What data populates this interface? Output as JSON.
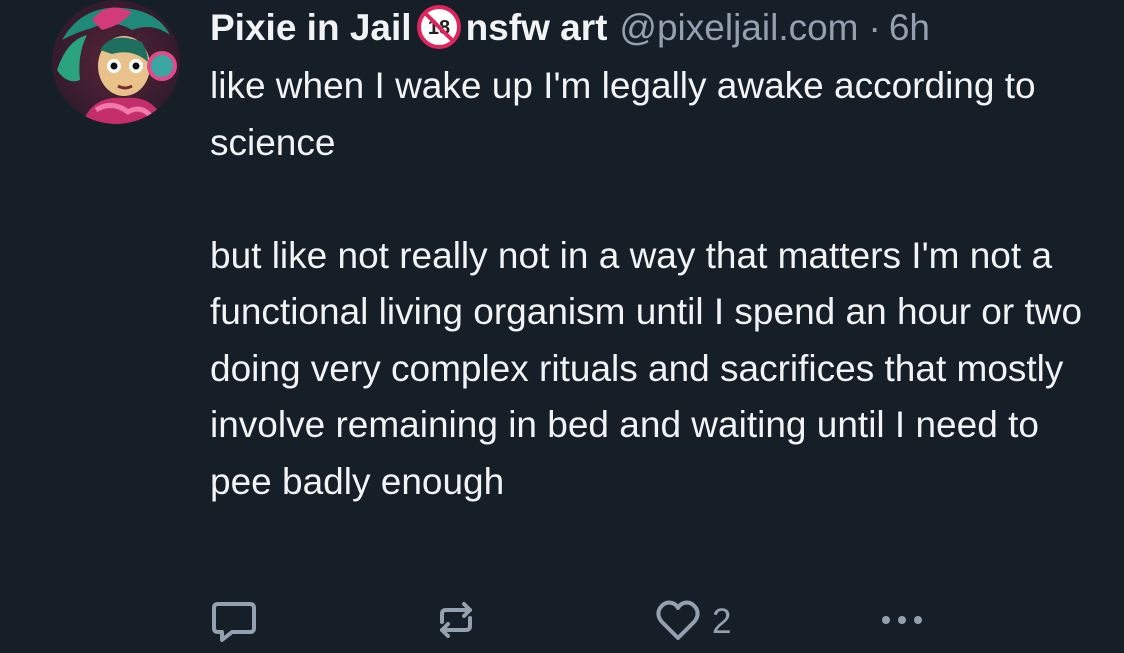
{
  "post": {
    "author": {
      "display_name": "Pixie in Jail",
      "display_name_suffix": "nsfw art",
      "badge_icon": "no-under-18-icon",
      "handle": "@pixeljail.com",
      "separator": "·",
      "time": "6h"
    },
    "text": {
      "paragraph_1": "like when I wake up I'm legally awake according to science",
      "paragraph_2": "but like not really not in a way that matters I'm not a functional living organism until I spend an hour or two doing very complex rituals and sacrifices that mostly involve remaining in bed and waiting until I need to pee badly enough"
    },
    "actions": {
      "reply_icon": "reply-icon",
      "repost_icon": "repost-icon",
      "like_icon": "heart-icon",
      "like_count": "2",
      "more_icon": "more-icon"
    }
  },
  "colors": {
    "background": "#161e27",
    "text_primary": "#f1f3f5",
    "text_secondary": "#93a0b0",
    "badge_red": "#e0245e"
  }
}
